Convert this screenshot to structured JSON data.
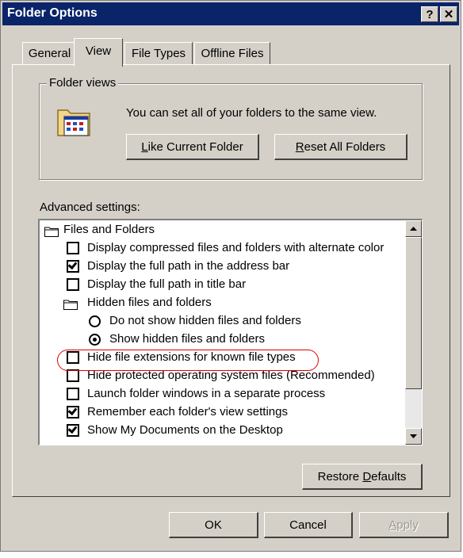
{
  "window": {
    "title": "Folder Options",
    "help_label": "?",
    "close_label": "✕"
  },
  "tabs": [
    "General",
    "View",
    "File Types",
    "Offline Files"
  ],
  "folder_views": {
    "legend": "Folder views",
    "description": "You can set all of your folders to the same view.",
    "like_current_prefix": "",
    "like_current_accel": "L",
    "like_current_rest": "ike Current Folder",
    "reset_all_prefix": "",
    "reset_all_accel": "R",
    "reset_all_rest": "eset All Folders"
  },
  "advanced": {
    "label": "Advanced settings:",
    "items": [
      {
        "type": "folder",
        "label": "Files and Folders"
      },
      {
        "type": "checkbox",
        "checked": false,
        "label": "Display compressed files and folders with alternate color"
      },
      {
        "type": "checkbox",
        "checked": true,
        "label": "Display the full path in the address bar"
      },
      {
        "type": "checkbox",
        "checked": false,
        "label": "Display the full path in title bar"
      },
      {
        "type": "folder",
        "label": "Hidden files and folders"
      },
      {
        "type": "radio",
        "checked": false,
        "label": "Do not show hidden files and folders"
      },
      {
        "type": "radio",
        "checked": true,
        "label": "Show hidden files and folders"
      },
      {
        "type": "checkbox",
        "checked": false,
        "label": "Hide file extensions for known file types"
      },
      {
        "type": "checkbox",
        "checked": false,
        "label": "Hide protected operating system files (Recommended)"
      },
      {
        "type": "checkbox",
        "checked": false,
        "label": "Launch folder windows in a separate process"
      },
      {
        "type": "checkbox",
        "checked": true,
        "label": "Remember each folder's view settings"
      },
      {
        "type": "checkbox",
        "checked": true,
        "label": "Show My Documents on the Desktop"
      }
    ]
  },
  "restore": {
    "prefix": "Restore ",
    "accel": "D",
    "rest": "efaults"
  },
  "footer": {
    "ok": "OK",
    "cancel": "Cancel",
    "apply_accel": "A",
    "apply_rest": "pply"
  },
  "colors": {
    "titlebar": "#0a246a",
    "face": "#d4d0c8",
    "highlight_ring": "#e00000"
  }
}
